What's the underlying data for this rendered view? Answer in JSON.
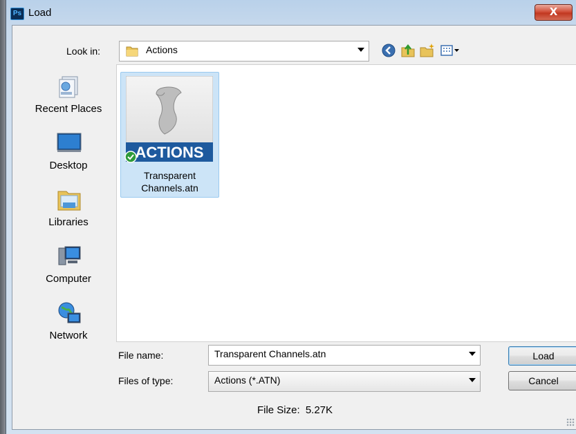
{
  "window": {
    "title": "Load",
    "app_icon": "Ps",
    "close_label": "X"
  },
  "look_in": {
    "label": "Look in:",
    "value": "Actions",
    "folder_icon": "folder-icon"
  },
  "toolbar": {
    "back_icon": "back-icon",
    "up_icon": "up-folder-icon",
    "new_folder_icon": "new-folder-icon",
    "view_menu_icon": "view-menu-icon"
  },
  "places": [
    {
      "label": "Recent Places",
      "icon": "recent-places-icon"
    },
    {
      "label": "Desktop",
      "icon": "desktop-icon"
    },
    {
      "label": "Libraries",
      "icon": "libraries-icon"
    },
    {
      "label": "Computer",
      "icon": "computer-icon"
    },
    {
      "label": "Network",
      "icon": "network-icon"
    }
  ],
  "files": [
    {
      "thumb_text": "ACTIONS",
      "name_line1": "Transparent",
      "name_line2": "Channels.atn",
      "selected": true,
      "status_icon": "checkmark-icon"
    }
  ],
  "form": {
    "file_name_label": "File name:",
    "file_name_value": "Transparent Channels.atn",
    "file_type_label": "Files of type:",
    "file_type_value": "Actions (*.ATN)",
    "load_button": "Load",
    "cancel_button": "Cancel"
  },
  "status": {
    "file_size_label": "File Size:",
    "file_size_value": "5.27K"
  },
  "colors": {
    "selection": "#cce4f7",
    "selection_border": "#99c9ef",
    "close_red": "#c13720",
    "actions_banner": "#1e5a9e"
  }
}
